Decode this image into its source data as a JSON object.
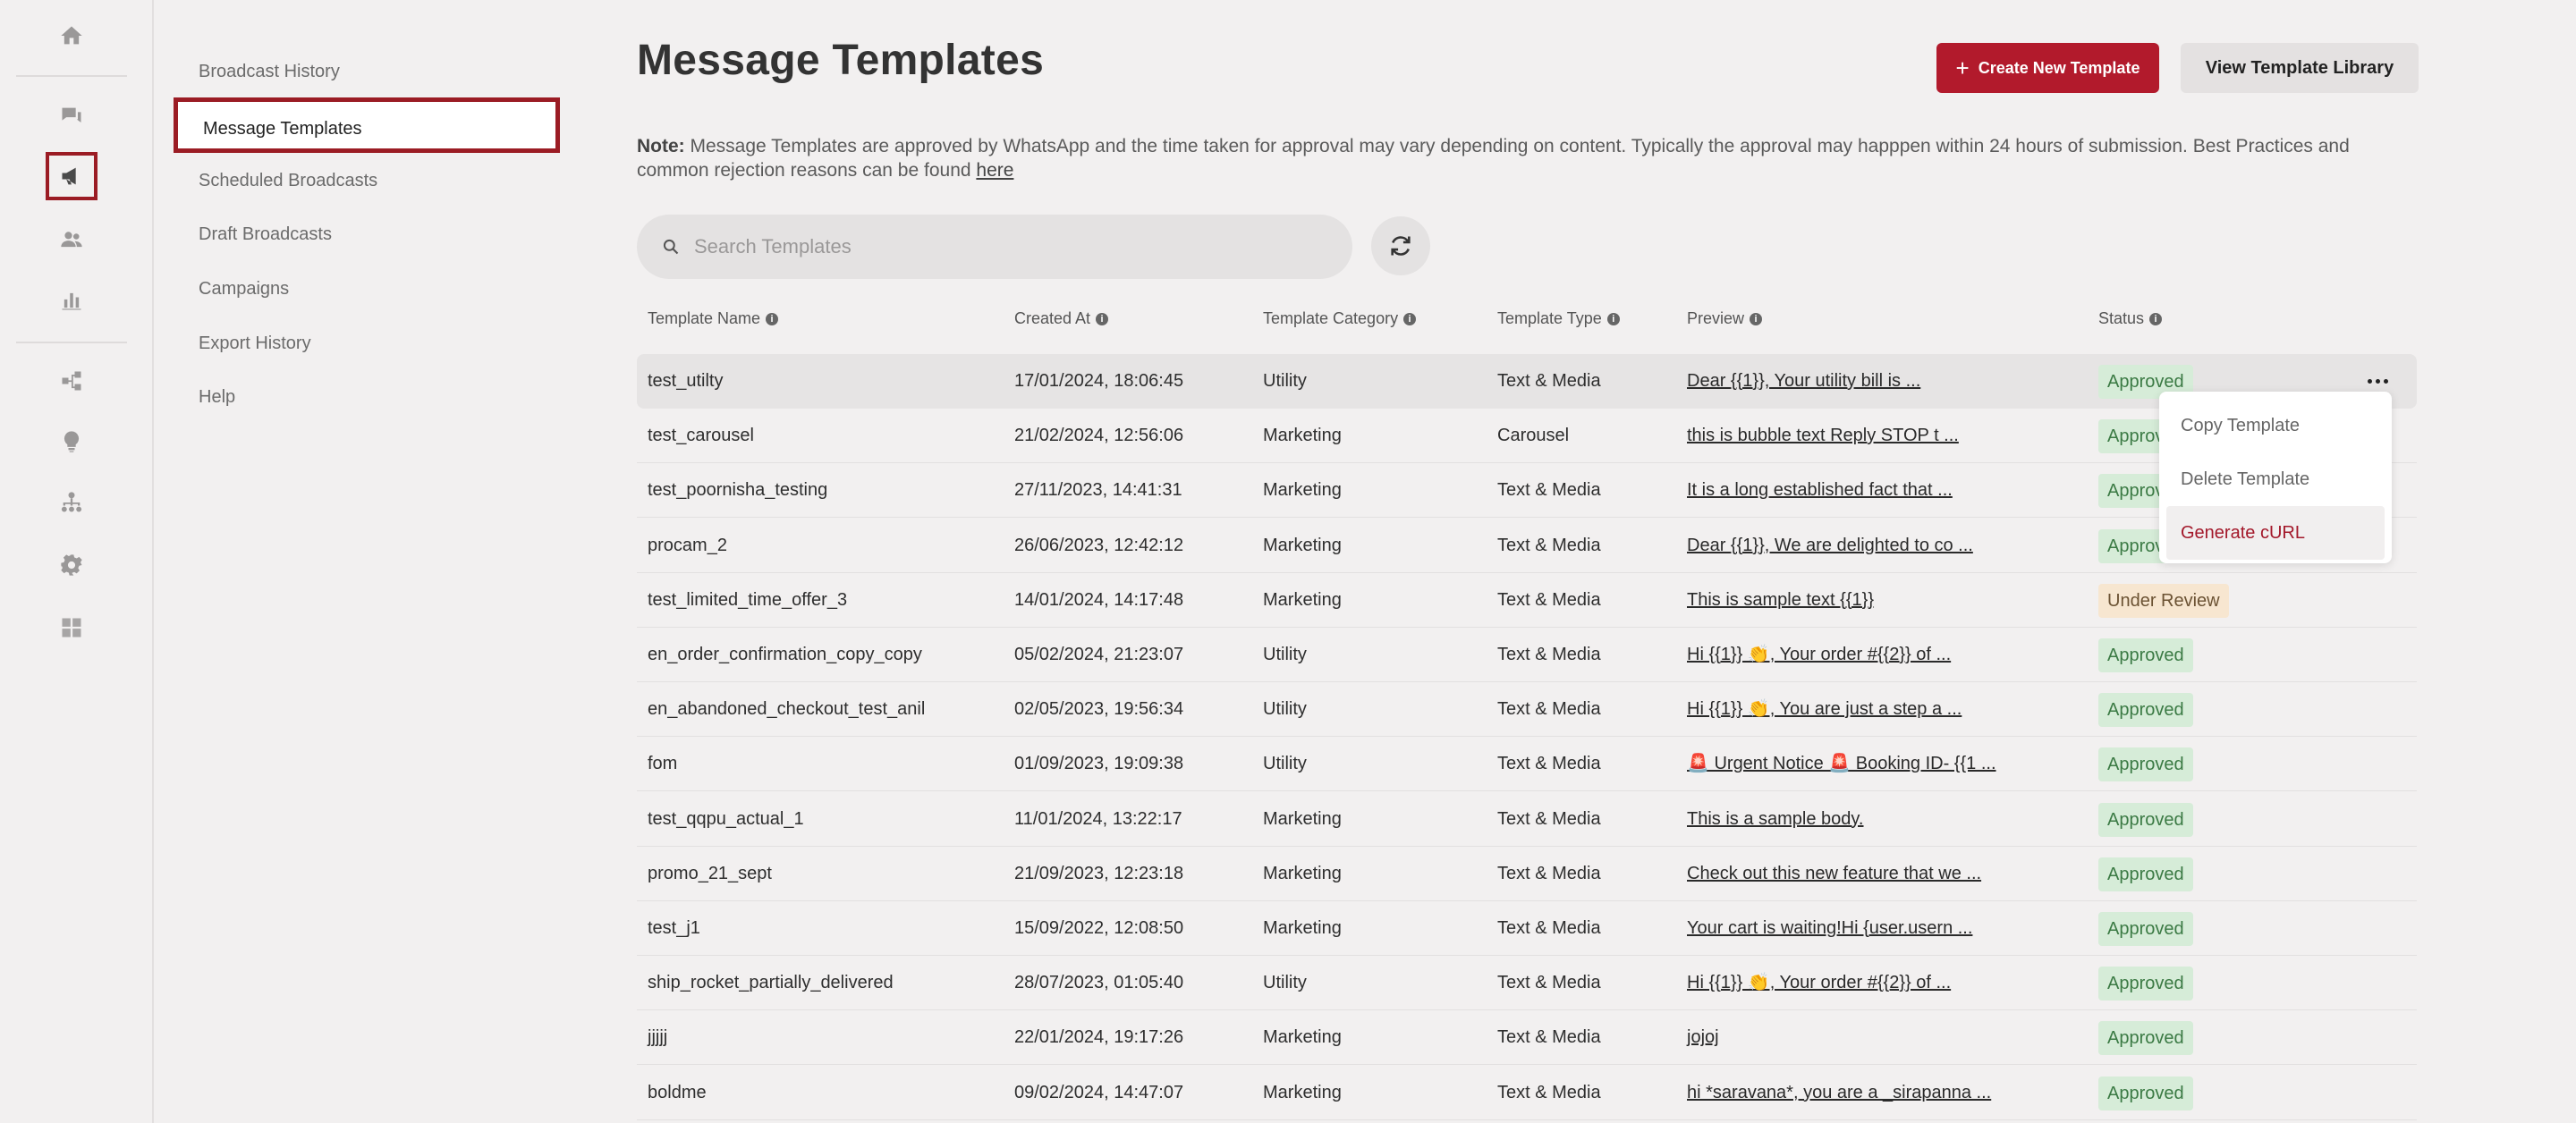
{
  "rail": {
    "icons": [
      "home-icon",
      "chat-icon",
      "megaphone-icon",
      "contacts-icon",
      "analytics-icon",
      "flow-icon",
      "bulb-icon",
      "hierarchy-icon",
      "settings-icon",
      "integrations-icon"
    ],
    "active": "megaphone-icon"
  },
  "subnav": {
    "items": [
      {
        "label": "Broadcast History"
      },
      {
        "label": "Message Templates"
      },
      {
        "label": "Scheduled Broadcasts"
      },
      {
        "label": "Draft Broadcasts"
      },
      {
        "label": "Campaigns"
      },
      {
        "label": "Export History"
      },
      {
        "label": "Help"
      }
    ],
    "active": "Message Templates"
  },
  "header": {
    "title": "Message Templates",
    "create_label": "Create New Template",
    "library_label": "View Template Library"
  },
  "note": {
    "label": "Note:",
    "text": " Message Templates are approved by WhatsApp and the time taken for approval may vary depending on content. Typically the approval may happpen within 24 hours of submission. Best Practices and common rejection reasons can be found ",
    "link": "here"
  },
  "search": {
    "placeholder": "Search Templates",
    "value": ""
  },
  "table": {
    "columns": [
      "Template Name",
      "Created At",
      "Template Category",
      "Template Type",
      "Preview",
      "Status"
    ],
    "rows": [
      {
        "name": "test_utilty",
        "created": "17/01/2024, 18:06:45",
        "category": "Utility",
        "type": "Text & Media",
        "preview": "Dear {{1}}, Your utility bill is ...",
        "status": "Approved"
      },
      {
        "name": "test_carousel",
        "created": "21/02/2024, 12:56:06",
        "category": "Marketing",
        "type": "Carousel",
        "preview": "this is bubble text Reply STOP t ...",
        "status": "Approved"
      },
      {
        "name": "test_poornisha_testing",
        "created": "27/11/2023, 14:41:31",
        "category": "Marketing",
        "type": "Text & Media",
        "preview": "It is a long established fact that ...",
        "status": "Approved"
      },
      {
        "name": "procam_2",
        "created": "26/06/2023, 12:42:12",
        "category": "Marketing",
        "type": "Text & Media",
        "preview": "Dear {{1}}, We are delighted to co ...",
        "status": "Approved"
      },
      {
        "name": "test_limited_time_offer_3",
        "created": "14/01/2024, 14:17:48",
        "category": "Marketing",
        "type": "Text & Media",
        "preview": "This is sample text {{1}}",
        "status": "Under Review"
      },
      {
        "name": "en_order_confirmation_copy_copy",
        "created": "05/02/2024, 21:23:07",
        "category": "Utility",
        "type": "Text & Media",
        "preview": "Hi {{1}} 👏, Your order #{{2}} of ...",
        "status": "Approved"
      },
      {
        "name": "en_abandoned_checkout_test_anil",
        "created": "02/05/2023, 19:56:34",
        "category": "Utility",
        "type": "Text & Media",
        "preview": "Hi {{1}} 👏, You are just a step a ...",
        "status": "Approved"
      },
      {
        "name": "fom",
        "created": "01/09/2023, 19:09:38",
        "category": "Utility",
        "type": "Text & Media",
        "preview": "🚨 Urgent Notice 🚨 Booking ID- {{1 ...",
        "status": "Approved"
      },
      {
        "name": "test_qqpu_actual_1",
        "created": "11/01/2024, 13:22:17",
        "category": "Marketing",
        "type": "Text & Media",
        "preview": "This is a sample body.",
        "status": "Approved"
      },
      {
        "name": "promo_21_sept",
        "created": "21/09/2023, 12:23:18",
        "category": "Marketing",
        "type": "Text & Media",
        "preview": "Check out this new feature that we ...",
        "status": "Approved"
      },
      {
        "name": "test_j1",
        "created": "15/09/2022, 12:08:50",
        "category": "Marketing",
        "type": "Text & Media",
        "preview": "Your cart is waiting!Hi {user.usern ...",
        "status": "Approved"
      },
      {
        "name": "ship_rocket_partially_delivered",
        "created": "28/07/2023, 01:05:40",
        "category": "Utility",
        "type": "Text & Media",
        "preview": "Hi {{1}} 👏, Your order #{{2}} of ...",
        "status": "Approved"
      },
      {
        "name": "jjjjj",
        "created": "22/01/2024, 19:17:26",
        "category": "Marketing",
        "type": "Text & Media",
        "preview": "jojoj",
        "status": "Approved"
      },
      {
        "name": "boldme",
        "created": "09/02/2024, 14:47:07",
        "category": "Marketing",
        "type": "Text & Media",
        "preview": "hi *saravana*, you are a _sirapanna ...",
        "status": "Approved"
      }
    ]
  },
  "row_menu": {
    "items": [
      "Copy Template",
      "Delete Template",
      "Generate cURL"
    ]
  },
  "colors": {
    "accent": "#b21a2c",
    "approved_bg": "#d6ecd8",
    "review_bg": "#f7e6d0"
  }
}
